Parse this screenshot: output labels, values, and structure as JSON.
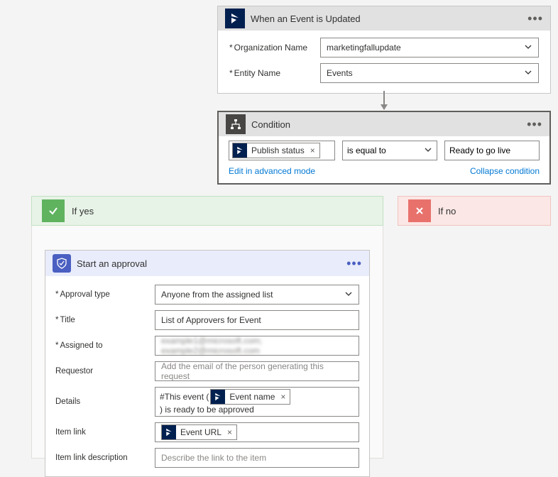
{
  "trigger": {
    "title": "When an Event is Updated",
    "fields": {
      "orgName": {
        "label": "Organization Name",
        "value": "marketingfallupdate"
      },
      "entityName": {
        "label": "Entity Name",
        "value": "Events"
      }
    }
  },
  "condition": {
    "title": "Condition",
    "token": "Publish status",
    "operator": "is equal to",
    "value": "Ready to go live",
    "editLink": "Edit in advanced mode",
    "collapseLink": "Collapse condition"
  },
  "branches": {
    "yes": "If yes",
    "no": "If no"
  },
  "approval": {
    "title": "Start an approval",
    "fields": {
      "approvalType": {
        "label": "Approval type",
        "value": "Anyone from the assigned list"
      },
      "titleField": {
        "label": "Title",
        "value": "List of Approvers for Event"
      },
      "assignedTo": {
        "label": "Assigned to",
        "value": "example1@microsoft.com; example2@microsoft.com"
      },
      "requestor": {
        "label": "Requestor",
        "placeholder": "Add the email of the person generating this request"
      },
      "details": {
        "label": "Details",
        "prefix": "#This event (",
        "token": "Event name",
        "suffix": ") is ready to be approved"
      },
      "itemLink": {
        "label": "Item link",
        "token": "Event URL"
      },
      "itemLinkDesc": {
        "label": "Item link description",
        "placeholder": "Describe the link to the item"
      }
    }
  }
}
